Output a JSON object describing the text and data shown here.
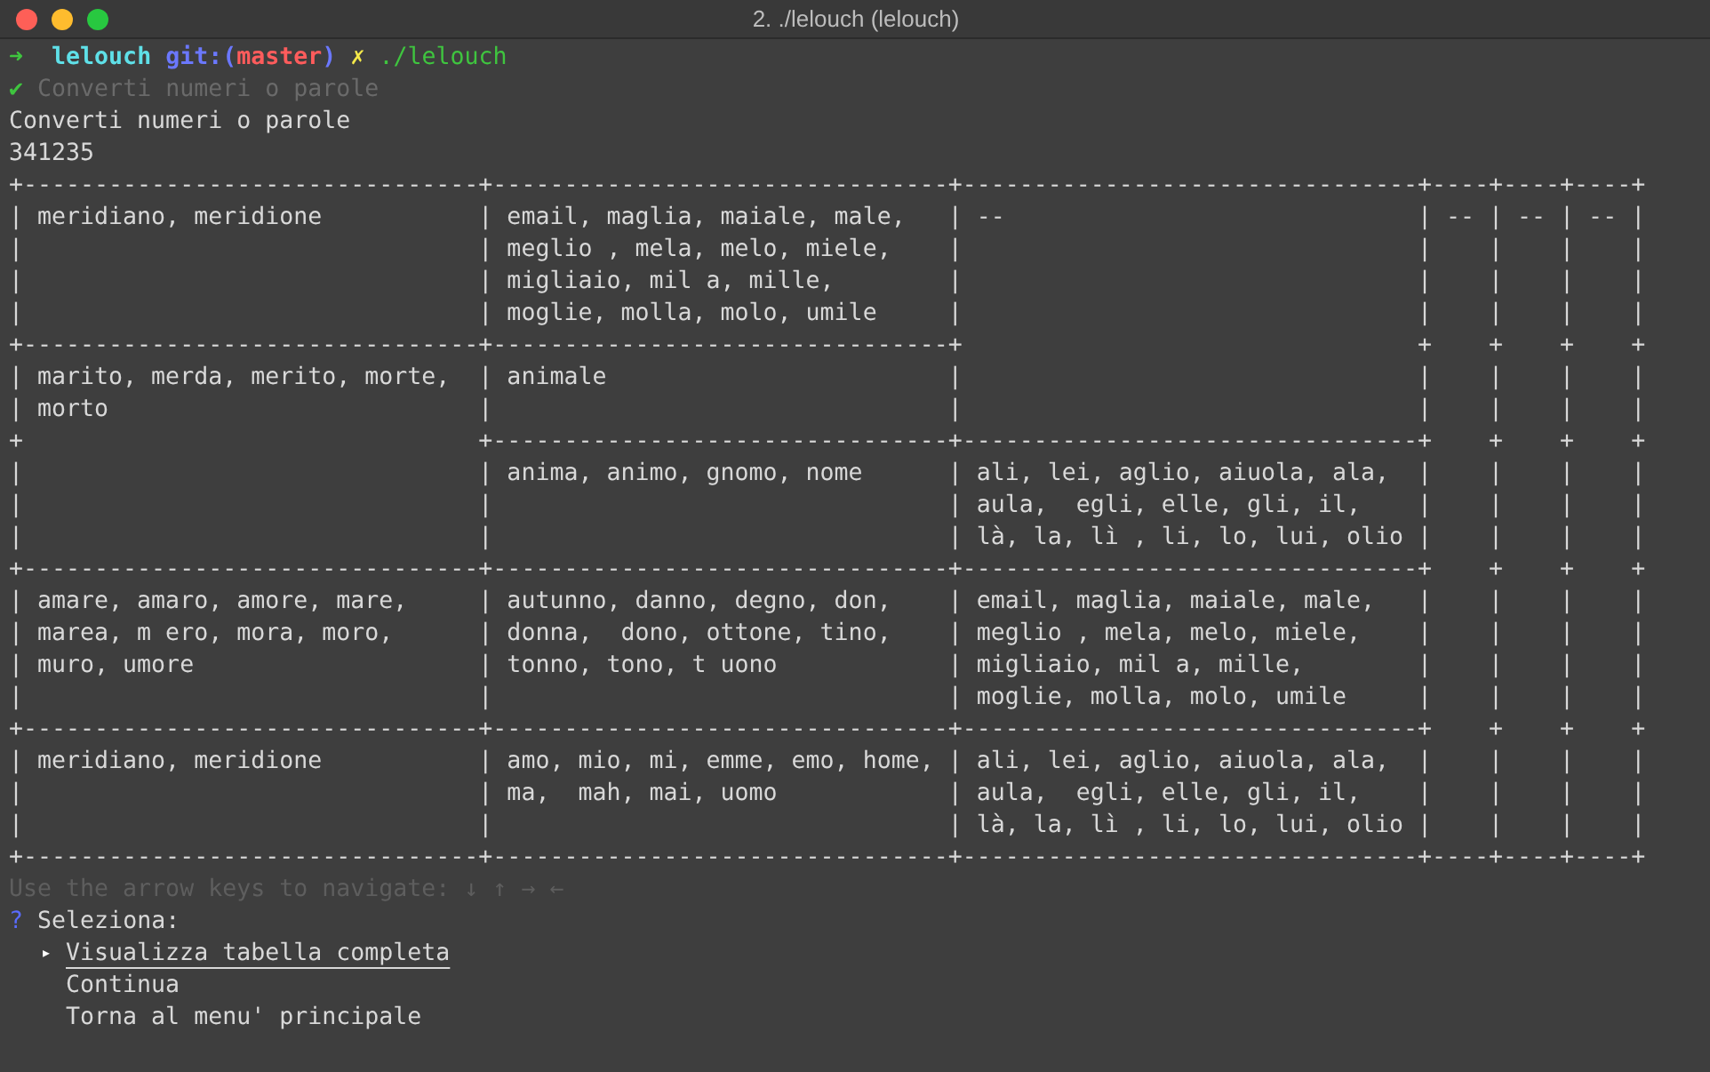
{
  "window": {
    "title": "2. ./lelouch (lelouch)"
  },
  "prompt": {
    "arrow": "➜",
    "directory": "lelouch",
    "git_open": "git:(",
    "branch": "master",
    "git_close": ")",
    "dirty_mark": "✗",
    "command": "./lelouch"
  },
  "completed": {
    "mark": "✔",
    "text": "Converti numeri o parole"
  },
  "output_lines": [
    "Converti numeri o parole",
    "341235"
  ],
  "table_lines": [
    [
      "+--------------------------------",
      "+--------------------------------",
      "+--------------------------------",
      "+----",
      "+----",
      "+----",
      "+"
    ],
    [
      "| meridiano, meridione",
      "| email, maglia, maiale, male,",
      "| --",
      "| --",
      "| --",
      "| --",
      "|"
    ],
    [
      "|",
      "| meglio , mela, melo, miele,",
      "|",
      "|",
      "|",
      "|",
      "|"
    ],
    [
      "|",
      "| migliaio, mil a, mille,",
      "|",
      "|",
      "|",
      "|",
      "|"
    ],
    [
      "|",
      "| moglie, molla, molo, umile",
      "|",
      "|",
      "|",
      "|",
      "|"
    ],
    [
      "+--------------------------------",
      "+--------------------------------",
      "+",
      "+",
      "+",
      "+",
      "+"
    ],
    [
      "| marito, merda, merito, morte,",
      "| animale",
      "|",
      "|",
      "|",
      "|",
      "|"
    ],
    [
      "| morto",
      "|",
      "|",
      "|",
      "|",
      "|",
      "|"
    ],
    [
      "+",
      "+--------------------------------",
      "+--------------------------------",
      "+",
      "+",
      "+",
      "+"
    ],
    [
      "|",
      "| anima, animo, gnomo, nome",
      "| ali, lei, aglio, aiuola, ala,",
      "|",
      "|",
      "|",
      "|"
    ],
    [
      "|",
      "|",
      "| aula,  egli, elle, gli, il,",
      "|",
      "|",
      "|",
      "|"
    ],
    [
      "|",
      "|",
      "| là, la, lì , li, lo, lui, olio",
      "|",
      "|",
      "|",
      "|"
    ],
    [
      "+--------------------------------",
      "+--------------------------------",
      "+--------------------------------",
      "+",
      "+",
      "+",
      "+"
    ],
    [
      "| amare, amaro, amore, mare,",
      "| autunno, danno, degno, don,",
      "| email, maglia, maiale, male,",
      "|",
      "|",
      "|",
      "|"
    ],
    [
      "| marea, m ero, mora, moro,",
      "| donna,  dono, ottone, tino,",
      "| meglio , mela, melo, miele,",
      "|",
      "|",
      "|",
      "|"
    ],
    [
      "| muro, umore",
      "| tonno, tono, t uono",
      "| migliaio, mil a, mille,",
      "|",
      "|",
      "|",
      "|"
    ],
    [
      "|",
      "|",
      "| moglie, molla, molo, umile",
      "|",
      "|",
      "|",
      "|"
    ],
    [
      "+--------------------------------",
      "+--------------------------------",
      "+--------------------------------",
      "+",
      "+",
      "+",
      "+"
    ],
    [
      "| meridiano, meridione",
      "| amo, mio, mi, emme, emo, home,",
      "| ali, lei, aglio, aiuola, ala,",
      "|",
      "|",
      "|",
      "|"
    ],
    [
      "|",
      "| ma,  mah, mai, uomo",
      "| aula,  egli, elle, gli, il,",
      "|",
      "|",
      "|",
      "|"
    ],
    [
      "|",
      "|",
      "| là, la, lì , li, lo, lui, olio",
      "|",
      "|",
      "|",
      "|"
    ],
    [
      "+--------------------------------",
      "+--------------------------------",
      "+--------------------------------",
      "+----",
      "+----",
      "+----",
      "+"
    ]
  ],
  "hint": "Use the arrow keys to navigate: ↓ ↑ → ←",
  "question": {
    "mark": "?",
    "text": "Seleziona:"
  },
  "menu": {
    "pointer": "▸",
    "items": [
      {
        "label": "Visualizza tabella completa",
        "selected": true
      },
      {
        "label": "Continua",
        "selected": false
      },
      {
        "label": "Torna al menu' principale",
        "selected": false
      }
    ]
  }
}
